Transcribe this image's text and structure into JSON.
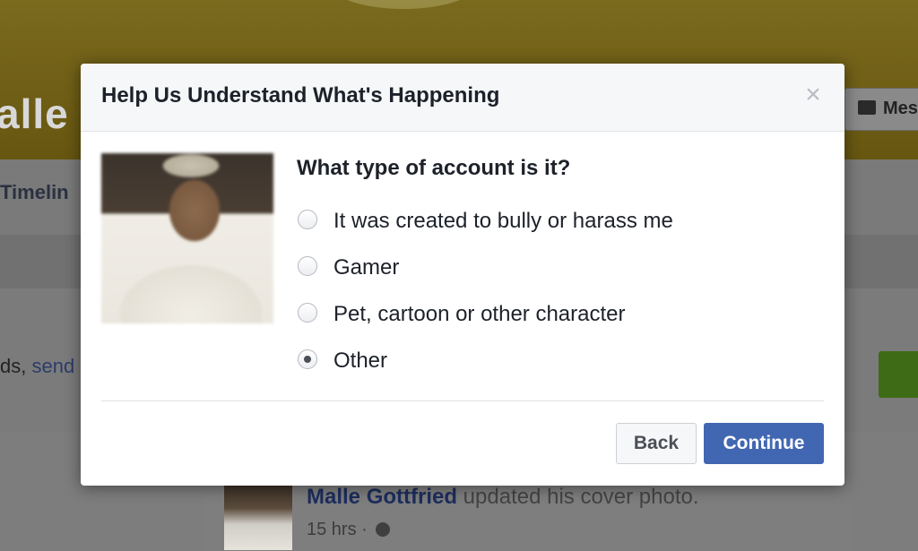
{
  "background": {
    "profile_name": "alle G",
    "message_button_label": "Mes",
    "tab_timeline": "Timelin",
    "friends_prefix": "ds, ",
    "friends_link": "send",
    "feed": {
      "author": "Malle Gottfried",
      "action": " updated his cover photo.",
      "time": "15 hrs · "
    }
  },
  "dialog": {
    "title": "Help Us Understand What's Happening",
    "close_glyph": "×",
    "question": "What type of account is it?",
    "options": [
      {
        "label": "It was created to bully or harass me",
        "selected": false
      },
      {
        "label": "Gamer",
        "selected": false
      },
      {
        "label": "Pet, cartoon or other character",
        "selected": false
      },
      {
        "label": "Other",
        "selected": true
      }
    ],
    "back_label": "Back",
    "continue_label": "Continue"
  },
  "colors": {
    "primary_button": "#4267b2",
    "link_text": "#365899",
    "add_friend_green": "#42b72a"
  }
}
